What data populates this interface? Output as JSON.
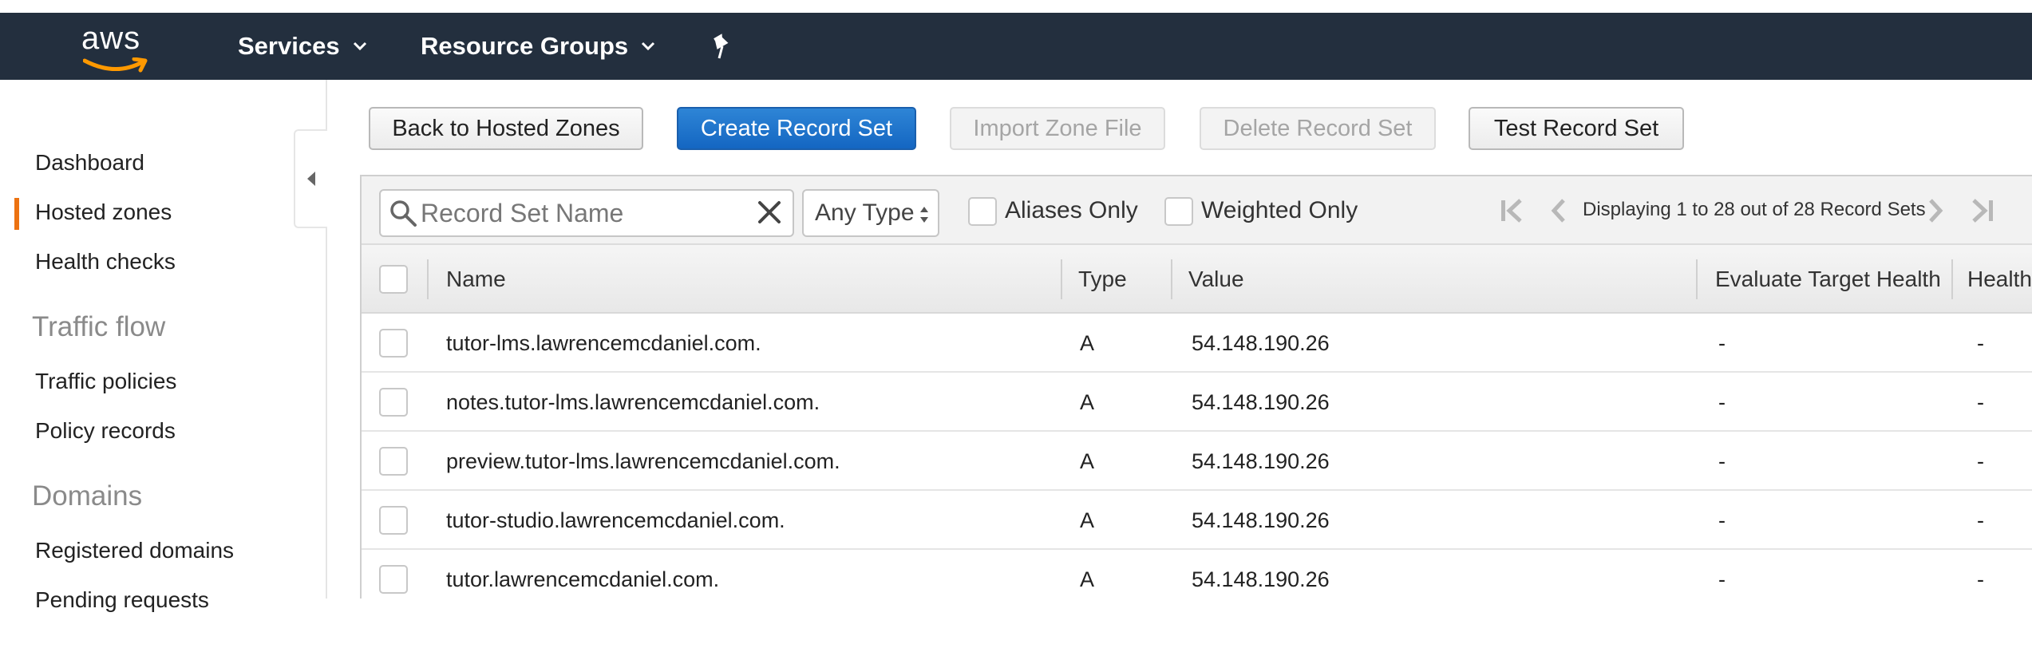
{
  "topnav": {
    "logo_text": "aws",
    "services_label": "Services",
    "resource_groups_label": "Resource Groups"
  },
  "sidebar": {
    "items": [
      {
        "label": "Dashboard"
      },
      {
        "label": "Hosted zones",
        "active": true
      },
      {
        "label": "Health checks"
      }
    ],
    "traffic_heading": "Traffic flow",
    "traffic_items": [
      {
        "label": "Traffic policies"
      },
      {
        "label": "Policy records"
      }
    ],
    "domains_heading": "Domains",
    "domain_items": [
      {
        "label": "Registered domains"
      },
      {
        "label": "Pending requests"
      }
    ]
  },
  "toolbar": {
    "back_label": "Back to Hosted Zones",
    "create_label": "Create Record Set",
    "import_label": "Import Zone File",
    "delete_label": "Delete Record Set",
    "test_label": "Test Record Set"
  },
  "filters": {
    "search_placeholder": "Record Set Name",
    "type_value": "Any Type",
    "aliases_label": "Aliases Only",
    "weighted_label": "Weighted Only",
    "pager_text": "Displaying 1 to 28 out of 28 Record Sets"
  },
  "table": {
    "columns": [
      "Name",
      "Type",
      "Value",
      "Evaluate Target Health",
      "Health"
    ],
    "rows": [
      {
        "name": "tutor-lms.lawrencemcdaniel.com.",
        "type": "A",
        "value": "54.148.190.26",
        "eval": "-",
        "health": "-"
      },
      {
        "name": "notes.tutor-lms.lawrencemcdaniel.com.",
        "type": "A",
        "value": "54.148.190.26",
        "eval": "-",
        "health": "-"
      },
      {
        "name": "preview.tutor-lms.lawrencemcdaniel.com.",
        "type": "A",
        "value": "54.148.190.26",
        "eval": "-",
        "health": "-"
      },
      {
        "name": "tutor-studio.lawrencemcdaniel.com.",
        "type": "A",
        "value": "54.148.190.26",
        "eval": "-",
        "health": "-"
      },
      {
        "name": "tutor.lawrencemcdaniel.com.",
        "type": "A",
        "value": "54.148.190.26",
        "eval": "-",
        "health": "-"
      }
    ]
  },
  "colors": {
    "nav_bg": "#232f3e",
    "primary_button": "#1466c2",
    "active_marker": "#ec7211"
  }
}
